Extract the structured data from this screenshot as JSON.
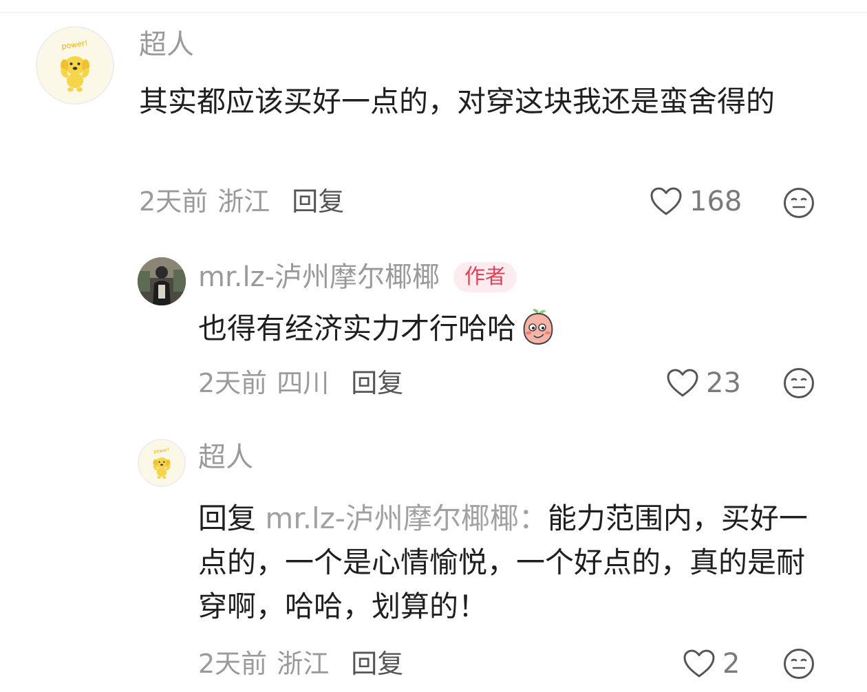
{
  "comments": [
    {
      "username": "超人",
      "content": "其实都应该买好一点的，对穿这块我还是蛮舍得的",
      "time": "2天前",
      "location": "浙江",
      "reply_label": "回复",
      "likes": "168",
      "avatar_icon": "power-dog-avatar"
    },
    {
      "username": "mr.lz-泸州摩尔椰椰",
      "badge": "作者",
      "content": "也得有经济实力才行哈哈",
      "emoji": "peach-emoji",
      "time": "2天前",
      "location": "四川",
      "reply_label": "回复",
      "likes": "23",
      "avatar_icon": "person-photo-avatar"
    },
    {
      "username": "超人",
      "reply_prefix": "回复",
      "reply_target": "mr.lz-泸州摩尔椰椰：",
      "content": "能力范围内，买好一点的，一个是心情愉悦，一个好点的，真的是耐穿啊，哈哈，划算的！",
      "time": "2天前",
      "location": "浙江",
      "reply_label": "回复",
      "likes": "2",
      "avatar_icon": "power-dog-avatar"
    }
  ],
  "colors": {
    "username": "#9a9a9a",
    "content": "#1f1f1f",
    "badge_bg": "#fdecef",
    "badge_text": "#e0425a",
    "meta": "#9a9a9a"
  }
}
